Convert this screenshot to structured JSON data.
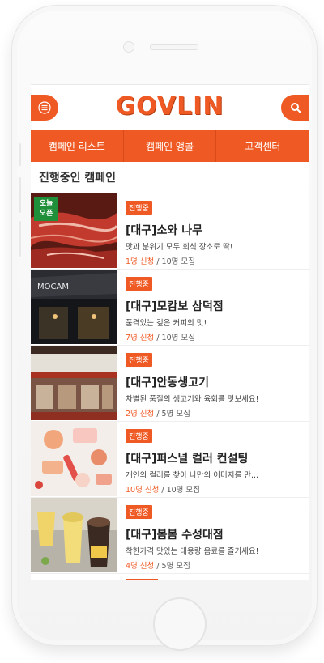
{
  "app": {
    "logo_text": "GOVLIN"
  },
  "nav": {
    "items": [
      {
        "label": "캠페인 리스트"
      },
      {
        "label": "캠페인 앵콜"
      },
      {
        "label": "고객센터"
      }
    ]
  },
  "section": {
    "title": "진행중인 캠페인"
  },
  "campaigns": [
    {
      "status": "진행중",
      "title": "[대구]소와 나무",
      "desc": "맛과 분위기 모두 회식 장소로 딱!",
      "applied": "1명 신청",
      "recruit": " / 10명 모집",
      "flag": "오늘 오픈",
      "flag_line1": "오늘",
      "flag_line2": "오픈"
    },
    {
      "status": "진행중",
      "title": "[대구]모캄보 삼덕점",
      "desc": "품격있는 깊은 커피의 맛!",
      "applied": "7명 신청",
      "recruit": " / 10명 모집"
    },
    {
      "status": "진행중",
      "title": "[대구]안동생고기",
      "desc": "차별된 품질의 생고기와 육회를 맛보세요!",
      "applied": "2명 신청",
      "recruit": " / 5명 모집"
    },
    {
      "status": "진행중",
      "title": "[대구]퍼스널 컬러 컨설팅",
      "desc": "개인의 컬러를 찾아 나만의 이미지를 만...",
      "applied": "10명 신청",
      "recruit": " / 10명 모집"
    },
    {
      "status": "진행중",
      "title": "[대구]봄봄 수성대점",
      "desc": "착한가격 맛있는 대용량 음료를 즐기세요!",
      "applied": "4명 신청",
      "recruit": " / 5명 모집"
    }
  ],
  "colors": {
    "accent": "#ef5a24",
    "flag": "#1f8f3a"
  },
  "icons": {
    "menu": "hamburger-icon",
    "search": "search-icon"
  }
}
